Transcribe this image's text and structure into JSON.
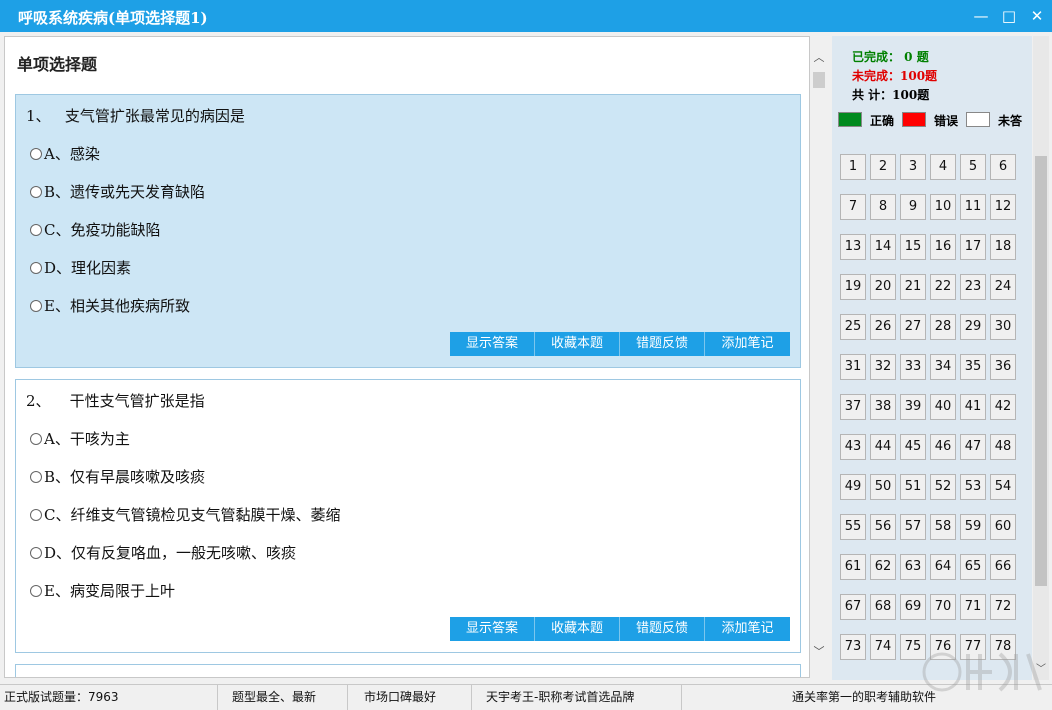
{
  "window": {
    "title": "呼吸系统疾病(单项选择题1)",
    "controls": {
      "minimize": "—",
      "maximize": "□",
      "close": "✕"
    }
  },
  "main": {
    "heading": "单项选择题",
    "questions": [
      {
        "text": "1、   支气管扩张最常见的病因是",
        "options": [
          "A、感染",
          "B、遗传或先天发育缺陷",
          "C、免疫功能缺陷",
          "D、理化因素",
          "E、相关其他疾病所致"
        ]
      },
      {
        "text": "2、    干性支气管扩张是指",
        "options": [
          "A、干咳为主",
          "B、仅有早晨咳嗽及咳痰",
          "C、纤维支气管镜检见支气管黏膜干燥、萎缩",
          "D、仅有反复咯血，一般无咳嗽、咳痰",
          "E、病变局限于上叶"
        ]
      }
    ],
    "actions": {
      "show_answer": "显示答案",
      "favorite": "收藏本题",
      "report_error": "错题反馈",
      "add_note": "添加笔记"
    }
  },
  "sidebar": {
    "completed": "已完成：  0 题",
    "incomplete": "未完成：100题",
    "total": "共    计：100题",
    "legend": {
      "correct": "正确",
      "wrong": "错误",
      "unanswered": "未答",
      "correct_color": "#008a1e",
      "wrong_color": "#ff0000",
      "unanswered_color": "#ffffff"
    },
    "numbers": [
      "1",
      "2",
      "3",
      "4",
      "5",
      "6",
      "7",
      "8",
      "9",
      "10",
      "11",
      "12",
      "13",
      "14",
      "15",
      "16",
      "17",
      "18",
      "19",
      "20",
      "21",
      "22",
      "23",
      "24",
      "25",
      "26",
      "27",
      "28",
      "29",
      "30",
      "31",
      "32",
      "33",
      "34",
      "35",
      "36",
      "37",
      "38",
      "39",
      "40",
      "41",
      "42",
      "43",
      "44",
      "45",
      "46",
      "47",
      "48",
      "49",
      "50",
      "51",
      "52",
      "53",
      "54",
      "55",
      "56",
      "57",
      "58",
      "59",
      "60",
      "61",
      "62",
      "63",
      "64",
      "65",
      "66",
      "67",
      "68",
      "69",
      "70",
      "71",
      "72",
      "73",
      "74",
      "75",
      "76",
      "77",
      "78"
    ]
  },
  "statusbar": {
    "trial": "正式版试题量：7963",
    "s1": "题型最全、最新",
    "s2": "市场口碑最好",
    "s3": "天宇考王-职称考试首选品牌",
    "s4": "通关率第一的职考辅助软件"
  },
  "colors": {
    "accent": "#1ea0e6",
    "active_card": "#cde6f5"
  }
}
